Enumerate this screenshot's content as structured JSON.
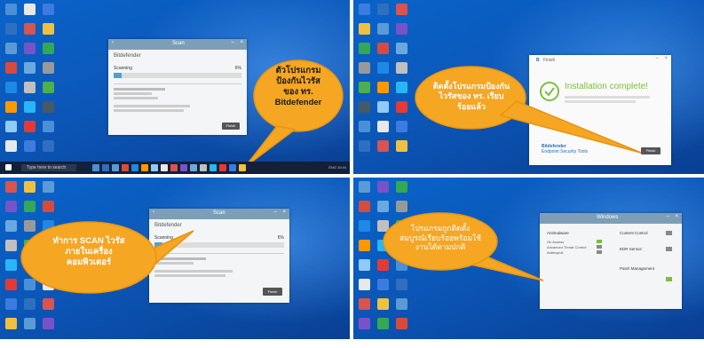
{
  "icon_colors": [
    "#4a90d9",
    "#e8e8e8",
    "#3c7be0",
    "#2f6fbf",
    "#d9534f",
    "#f0c040",
    "#5b9bd5",
    "#7a52c7",
    "#34a853",
    "#d84b3c",
    "#6aa8e0",
    "#999999",
    "#1e88e5",
    "#c0c0c0",
    "#4caf50",
    "#ff9800",
    "#29b6f6",
    "#455a64",
    "#90caf9",
    "#e53935"
  ],
  "panel1": {
    "window_title": "Scan",
    "heading": "Bitdefender",
    "scan_label": "Scanning",
    "scan_percent": "6%",
    "progress": 0.06,
    "finish_button": "Finish",
    "bubble_text": [
      "ตัวโปรแกรม",
      "ป้องกันไวรัส",
      "ของ ทร.",
      "Bitdefender"
    ]
  },
  "panel2": {
    "window_title": "Finish",
    "complete_text": "Installation complete!",
    "brand_line1": "Bitdefender",
    "brand_line2": "Endpoint Security Tools",
    "finish_button": "Finish",
    "bubble_text": [
      "ติดตั้งโปรแกรมป้องกัน",
      "ไวรัสของ ทร. เรียบ",
      "ร้อยแล้ว"
    ]
  },
  "panel3": {
    "window_title": "Scan",
    "heading": "Bitdefender",
    "scan_label": "Scanning",
    "scan_percent": "6%",
    "progress": 0.06,
    "finish_button": "Finish",
    "bubble_text": [
      "ทำการ SCAN ไวรัส",
      "ภายในเครื่อง",
      "คอมพิวเตอร์"
    ]
  },
  "panel4": {
    "window_title": "Windows",
    "antimalware": "Antimalware",
    "on_access": "On Access",
    "advanced_threat": "Advanced Threat Control",
    "antiexploit": "Antiexploit",
    "content_control": "Content Control",
    "edr_sensor": "EDR Sensor",
    "patch_management": "Patch Management",
    "bubble_text": [
      "โปรแกรมถูกติดตั้ง",
      "สมบูรณ์เรียบร้อยพร้อมใช้",
      "งานได้ตามปกติ"
    ]
  },
  "taskbar": {
    "search_placeholder": "Type here to search",
    "tray": "ENG 10:44"
  },
  "colors": {
    "bubble_fill": "#f5a623",
    "bubble_stroke": "#e8940f",
    "desktop": "#0a57b8",
    "taskbar": "#12203a",
    "titlebar": "#7d9eb7",
    "check_green": "#7cbf3f"
  }
}
